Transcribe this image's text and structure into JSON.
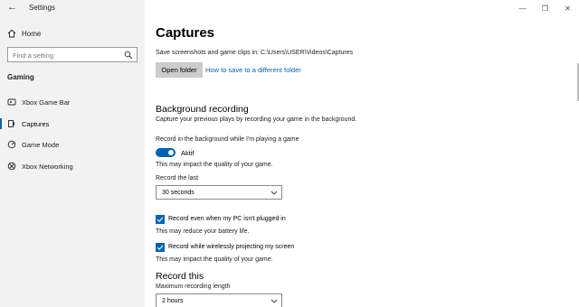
{
  "window": {
    "title": "Settings",
    "minimize_glyph": "—",
    "maximize_glyph": "❐",
    "close_glyph": "✕"
  },
  "sidebar": {
    "back_glyph": "←",
    "home_label": "Home",
    "search_placeholder": "Find a setting",
    "section_title": "Gaming",
    "items": [
      {
        "label": "Xbox Game Bar",
        "icon": "xbox-game-bar-icon",
        "active": false
      },
      {
        "label": "Captures",
        "icon": "captures-icon",
        "active": true
      },
      {
        "label": "Game Mode",
        "icon": "game-mode-icon",
        "active": false
      },
      {
        "label": "Xbox Networking",
        "icon": "xbox-networking-icon",
        "active": false
      }
    ]
  },
  "main": {
    "title": "Captures",
    "save_path": "Save screenshots and game clips in: C:\\Users\\USER\\Videos\\Captures",
    "open_folder_label": "Open folder",
    "help_link": "How to save to a different folder",
    "background_recording": {
      "heading": "Background recording",
      "description": "Capture your previous plays by recording your game in the background.",
      "toggle_label": "Record in the background while I'm playing a game",
      "toggle_state": "Aktif",
      "toggle_on": true,
      "toggle_note": "This may impact the quality of your game.",
      "record_last_label": "Record the last",
      "record_last_value": "30 seconds",
      "checkbox1_label": "Record even when my PC isn't plugged in",
      "checkbox1_checked": true,
      "checkbox1_note": "This may reduce your battery life.",
      "checkbox2_label": "Record while wirelessly projecting my screen",
      "checkbox2_checked": true,
      "checkbox2_note": "This may impact the quality of your game."
    },
    "record_this": {
      "heading": "Record this",
      "max_length_label": "Maximum recording length",
      "max_length_value": "2 hours"
    }
  },
  "colors": {
    "accent": "#0063b1",
    "link": "#0066b4",
    "sidebar_bg": "#f2f2f2",
    "button_bg": "#cccccc"
  }
}
